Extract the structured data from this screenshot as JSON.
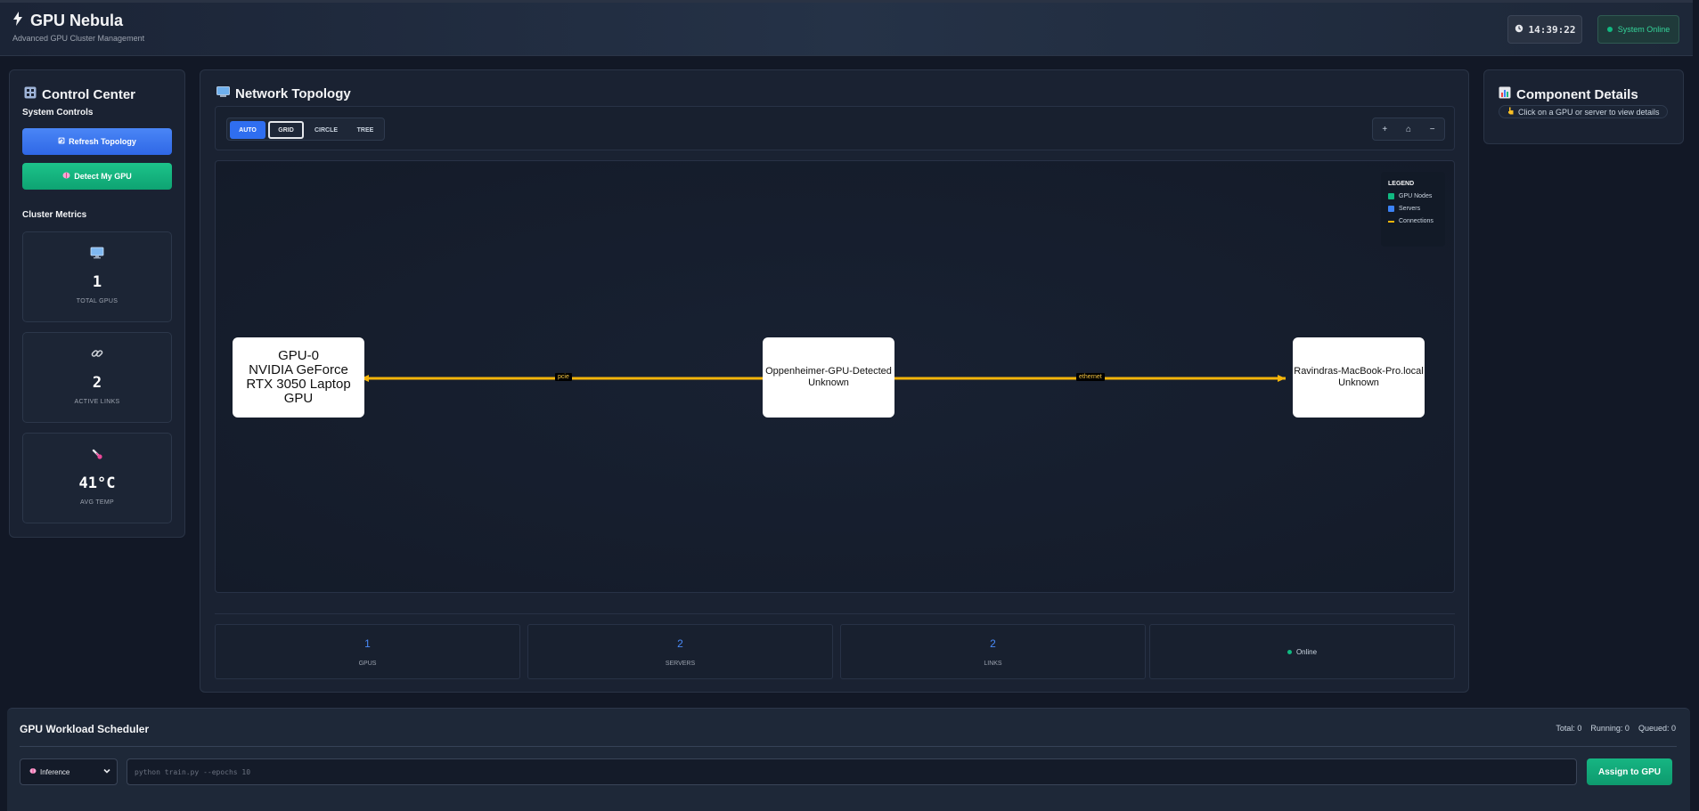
{
  "header": {
    "title": "GPU Nebula",
    "subtitle": "Advanced GPU Cluster Management",
    "clock_icon": "clock-icon",
    "time": "14:39:22",
    "status": "System Online"
  },
  "control_center": {
    "title": "Control Center",
    "system_controls_label": "System Controls",
    "refresh_label": "Refresh Topology",
    "detect_label": "Detect My GPU",
    "metrics_label": "Cluster Metrics",
    "metrics": [
      {
        "icon": "monitor-icon",
        "value": "1",
        "label": "TOTAL GPUS"
      },
      {
        "icon": "link-icon",
        "value": "2",
        "label": "ACTIVE LINKS"
      },
      {
        "icon": "thermometer-icon",
        "value": "41°C",
        "label": "AVG TEMP"
      }
    ]
  },
  "topology": {
    "title": "Network Topology",
    "layouts": [
      "AUTO",
      "GRID",
      "CIRCLE",
      "TREE"
    ],
    "active_layout": "AUTO",
    "zoom_controls": [
      "+",
      "⌂",
      "−"
    ],
    "legend": {
      "title": "LEGEND",
      "items": [
        {
          "label": "GPU Nodes",
          "color": "#10b981"
        },
        {
          "label": "Servers",
          "color": "#3b82f6"
        },
        {
          "label": "Connections",
          "color": "#f5b50a"
        }
      ]
    },
    "nodes": [
      {
        "lines": [
          "GPU-0",
          "NVIDIA GeForce",
          "RTX 3050 Laptop",
          "GPU"
        ]
      },
      {
        "lines": [
          "Oppenheimer-GPU-Detected",
          "Unknown"
        ]
      },
      {
        "lines": [
          "Ravindras-MacBook-Pro.local",
          "Unknown"
        ]
      }
    ],
    "edges": [
      {
        "label": "pcie"
      },
      {
        "label": "ethernet"
      }
    ],
    "edge_color": "#f5b50a",
    "stats": [
      {
        "value": "1",
        "label": "GPUS"
      },
      {
        "value": "2",
        "label": "SERVERS"
      },
      {
        "value": "2",
        "label": "LINKS"
      },
      {
        "status": "Online"
      }
    ]
  },
  "details": {
    "title": "Component Details",
    "hint": "Click on a GPU or server to view details"
  },
  "scheduler": {
    "title": "GPU Workload Scheduler",
    "total": "Total: 0",
    "running": "Running: 0",
    "queued": "Queued: 0",
    "workload_type": "Inference",
    "command_placeholder": "python train.py --epochs 10",
    "assign_label": "Assign to GPU"
  }
}
